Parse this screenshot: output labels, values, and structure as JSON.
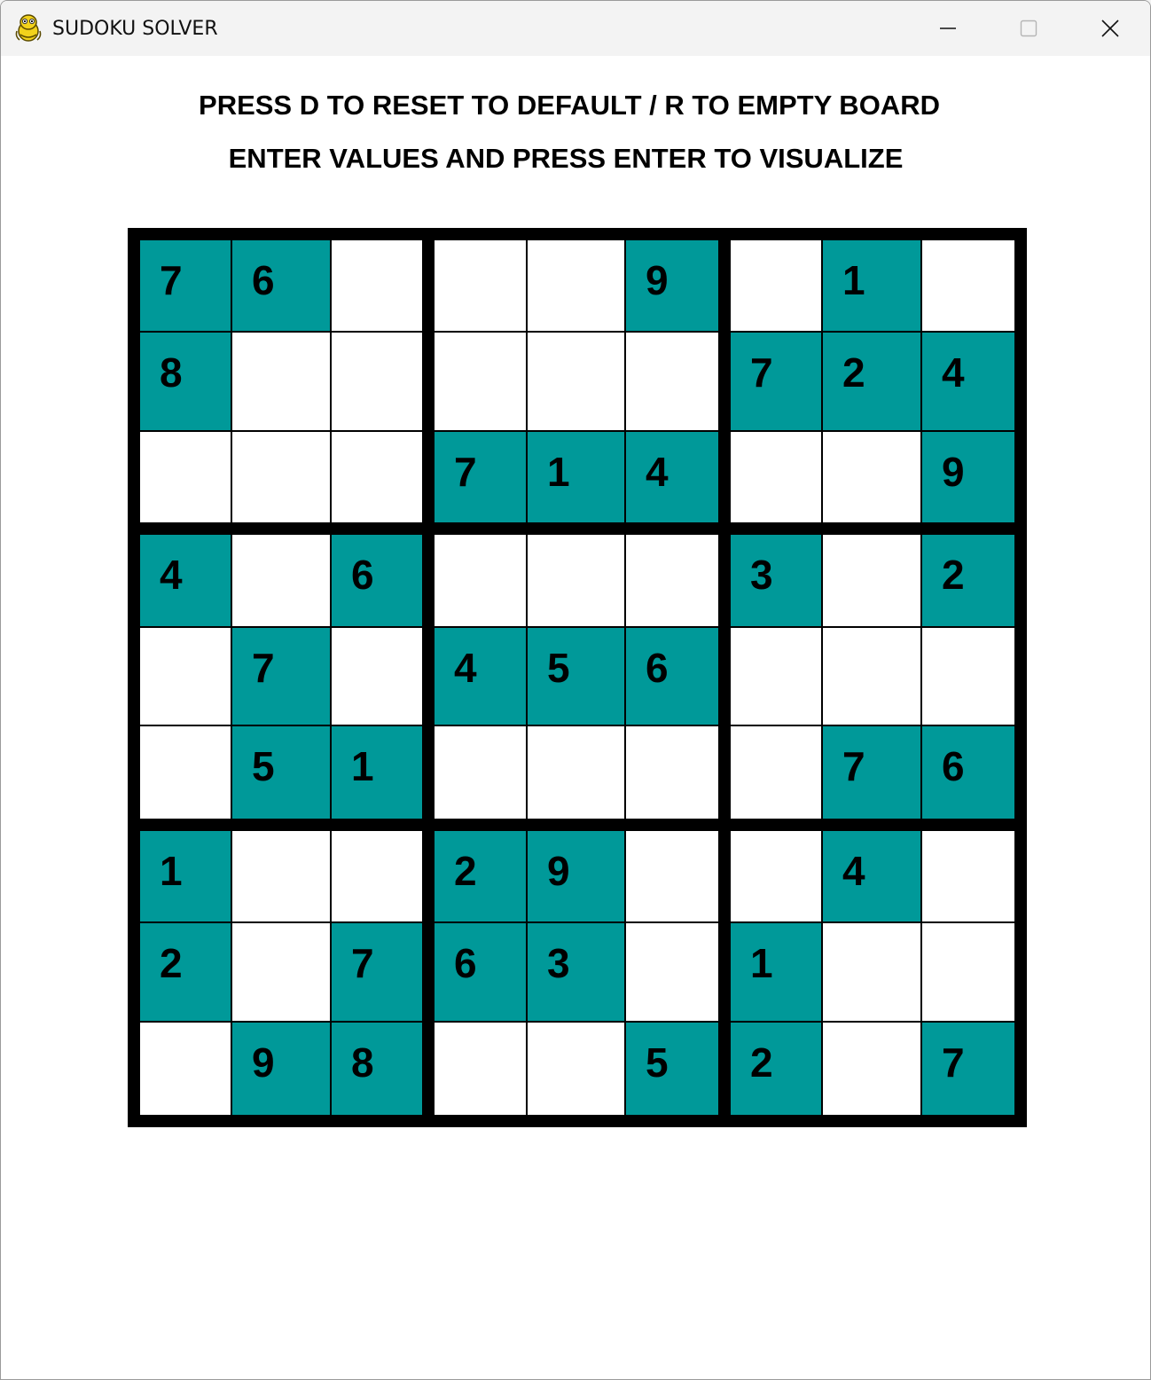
{
  "window": {
    "title": "SUDOKU SOLVER",
    "icon": "snake-python-icon",
    "controls": [
      "minimize-icon",
      "maximize-icon",
      "close-icon"
    ]
  },
  "instructions": {
    "line1": "PRESS D TO RESET TO DEFAULT / R TO EMPTY BOARD",
    "line2": "ENTER VALUES AND PRESS ENTER TO VISUALIZE"
  },
  "colors": {
    "filled_cell": "#009999",
    "empty_cell": "#ffffff",
    "grid_line": "#000000",
    "digit": "#000000"
  },
  "board": {
    "rows": [
      [
        "7",
        "6",
        "",
        "",
        "",
        "9",
        "",
        "1",
        ""
      ],
      [
        "8",
        "",
        "",
        "",
        "",
        "",
        "7",
        "2",
        "4"
      ],
      [
        "",
        "",
        "",
        "7",
        "1",
        "4",
        "",
        "",
        "9"
      ],
      [
        "4",
        "",
        "6",
        "",
        "",
        "",
        "3",
        "",
        "2"
      ],
      [
        "",
        "7",
        "",
        "4",
        "5",
        "6",
        "",
        "",
        ""
      ],
      [
        "",
        "5",
        "1",
        "",
        "",
        "",
        "",
        "7",
        "6"
      ],
      [
        "1",
        "",
        "",
        "2",
        "9",
        "",
        "",
        "4",
        ""
      ],
      [
        "2",
        "",
        "7",
        "6",
        "3",
        "",
        "1",
        "",
        ""
      ],
      [
        "",
        "9",
        "8",
        "",
        "",
        "5",
        "2",
        "",
        "7"
      ]
    ]
  }
}
